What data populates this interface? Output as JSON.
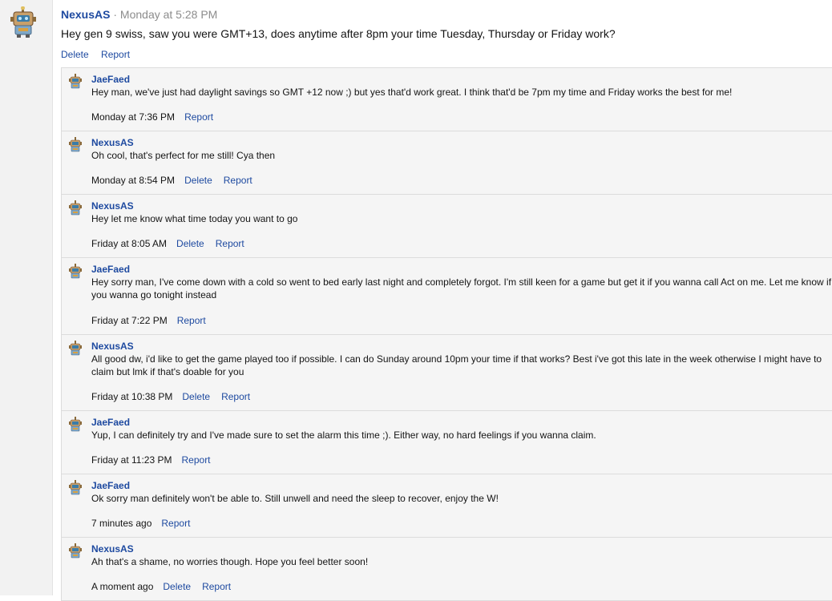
{
  "main_post": {
    "author": "NexusAS",
    "separator": "·",
    "time": "Monday at 5:28 PM",
    "text": "Hey gen 9 swiss, saw you were GMT+13, does anytime after 8pm your time Tuesday, Thursday or Friday work?",
    "delete_label": "Delete",
    "report_label": "Report"
  },
  "comments": [
    {
      "author": "JaeFaed",
      "avatar_icon": "robot-avatar-icon",
      "text": "Hey man, we've just had daylight savings so GMT +12 now ;) but yes that'd work great. I think that'd be 7pm my time and Friday works the best for me!",
      "time": "Monday at 7:36 PM",
      "delete_label": "",
      "report_label": "Report"
    },
    {
      "author": "NexusAS",
      "avatar_icon": "robot-avatar-icon",
      "text": "Oh cool, that's perfect for me still! Cya then",
      "time": "Monday at 8:54 PM",
      "delete_label": "Delete",
      "report_label": "Report"
    },
    {
      "author": "NexusAS",
      "avatar_icon": "robot-avatar-icon",
      "text": "Hey let me know what time today you want to go",
      "time": "Friday at 8:05 AM",
      "delete_label": "Delete",
      "report_label": "Report"
    },
    {
      "author": "JaeFaed",
      "avatar_icon": "robot-avatar-icon",
      "text": "Hey sorry man, I've come down with a cold so went to bed early last night and completely forgot. I'm still keen for a game but get it if you wanna call Act on me. Let me know if you wanna go tonight instead",
      "time": "Friday at 7:22 PM",
      "delete_label": "",
      "report_label": "Report"
    },
    {
      "author": "NexusAS",
      "avatar_icon": "robot-avatar-icon",
      "text": "All good dw, i'd like to get the game played too if possible. I can do Sunday around 10pm your time if that works? Best i've got this late in the week otherwise I might have to claim but lmk if that's doable for you",
      "time": "Friday at 10:38 PM",
      "delete_label": "Delete",
      "report_label": "Report"
    },
    {
      "author": "JaeFaed",
      "avatar_icon": "robot-avatar-icon",
      "text": "Yup, I can definitely try and I've made sure to set the alarm this time ;). Either way, no hard feelings if you wanna claim.",
      "time": "Friday at 11:23 PM",
      "delete_label": "",
      "report_label": "Report"
    },
    {
      "author": "JaeFaed",
      "avatar_icon": "robot-avatar-icon",
      "text": "Ok sorry man definitely won't be able to. Still unwell and need the sleep to recover, enjoy the W!",
      "time": "7 minutes ago",
      "delete_label": "",
      "report_label": "Report"
    },
    {
      "author": "NexusAS",
      "avatar_icon": "robot-avatar-icon",
      "text": "Ah that's a shame, no worries though. Hope you feel better soon!",
      "time": "A moment ago",
      "delete_label": "Delete",
      "report_label": "Report"
    }
  ]
}
